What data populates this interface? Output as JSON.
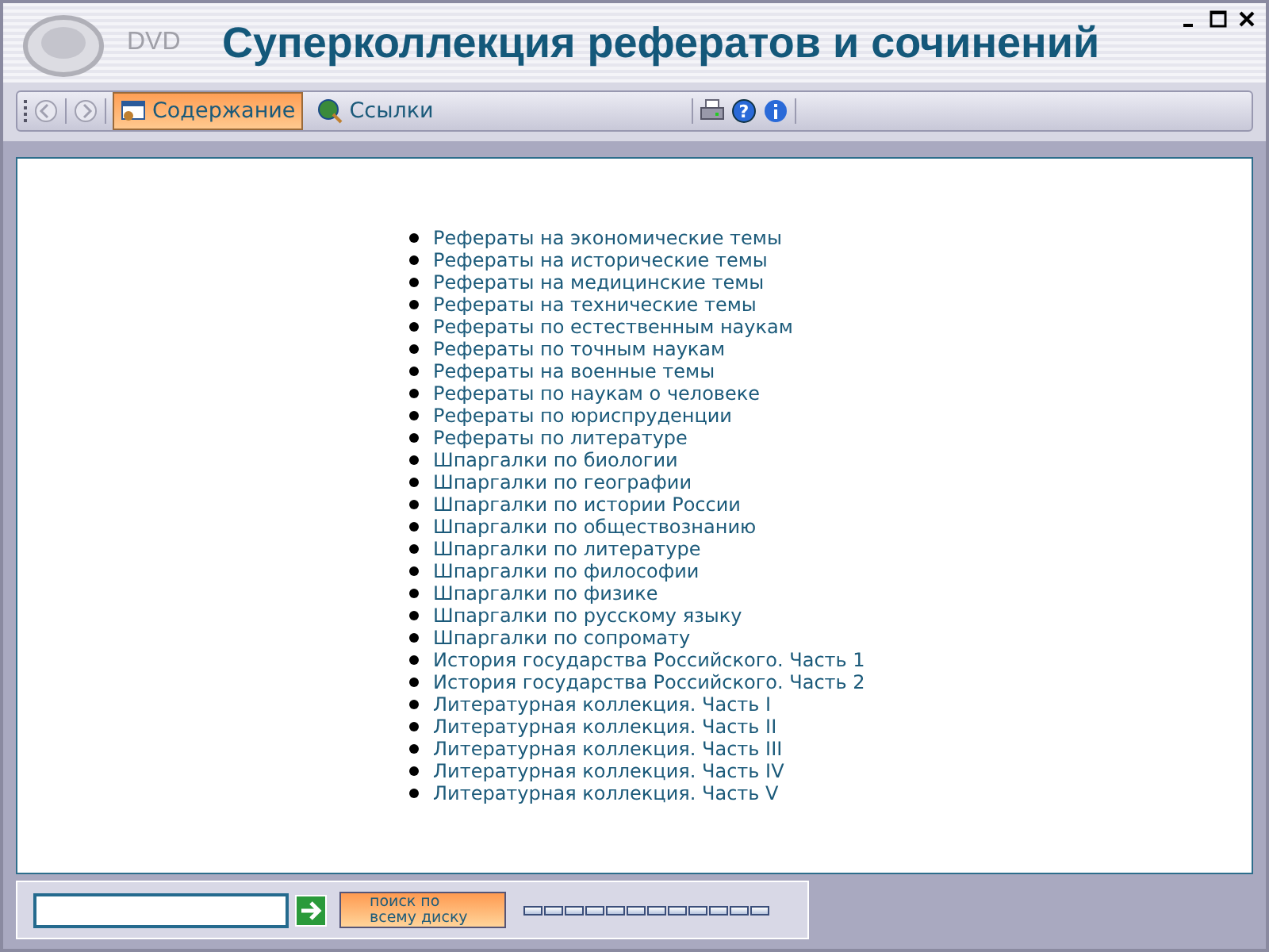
{
  "window": {
    "logo_text": "DVD",
    "title": "Суперколлекция рефератов и сочинений"
  },
  "toolbar": {
    "nav": [
      {
        "kind": "back",
        "disabled": true
      },
      {
        "kind": "forward",
        "disabled": true
      }
    ],
    "tabs": [
      {
        "label": "Содержание",
        "kind": "contents",
        "selected": true
      },
      {
        "label": "Ссылки",
        "kind": "links",
        "selected": false
      }
    ],
    "tools": [
      {
        "kind": "print"
      },
      {
        "kind": "help",
        "glyph": "?"
      },
      {
        "kind": "info"
      }
    ]
  },
  "links": [
    "Рефераты на экономические темы",
    "Рефераты на исторические темы",
    "Рефераты на медицинские темы",
    "Рефераты на технические темы",
    "Рефераты по естественным наукам",
    "Рефераты по точным наукам",
    "Рефераты на военные темы",
    "Рефераты по наукам о человеке",
    "Рефераты по юриспруденции",
    "Рефераты по литературе",
    "Шпаргалки по биологии",
    "Шпаргалки по географии",
    "Шпаргалки по истории России",
    "Шпаргалки по обществознанию",
    "Шпаргалки по литературе",
    "Шпаргалки по философии",
    "Шпаргалки по физике",
    "Шпаргалки по русскому языку",
    "Шпаргалки по сопромату",
    "История государства Российского. Часть 1",
    "История государства Российского. Часть 2",
    "Литературная коллекция. Часть I",
    "Литературная коллекция. Часть II",
    "Литературная коллекция. Часть III",
    "Литературная коллекция. Часть IV",
    "Литературная коллекция. Часть V"
  ],
  "search": {
    "button_lines": [
      "поиск по",
      "всему диску"
    ]
  }
}
